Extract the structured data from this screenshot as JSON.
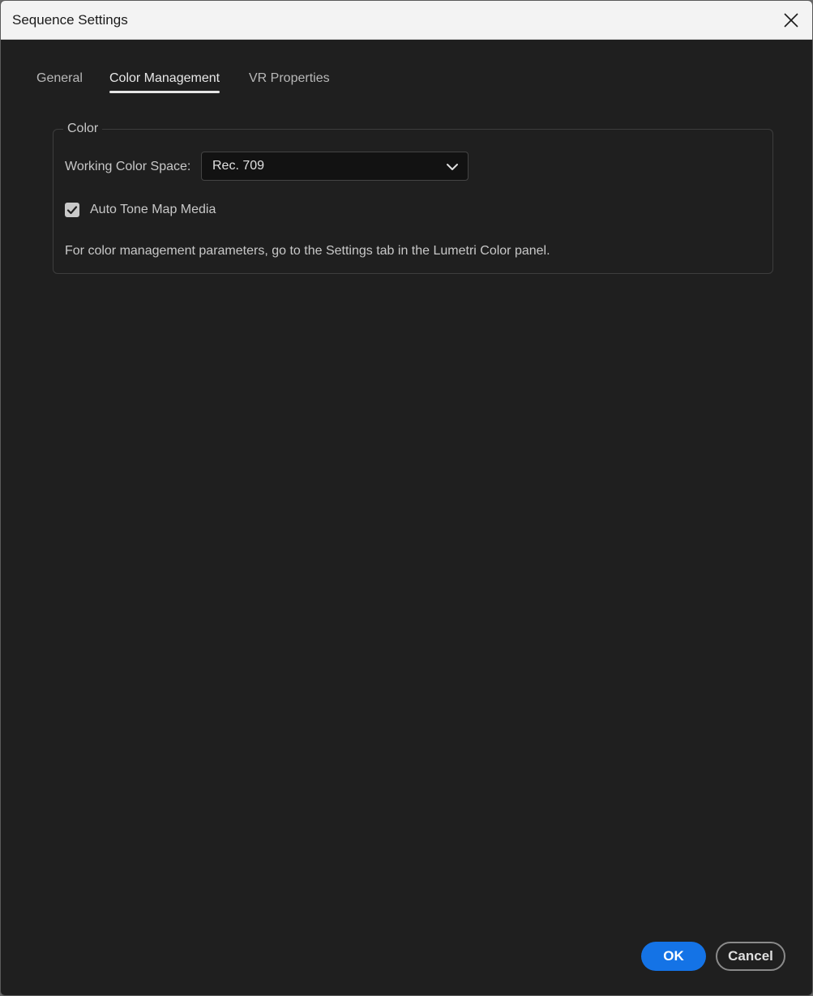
{
  "window": {
    "title": "Sequence Settings"
  },
  "tabs": [
    {
      "label": "General",
      "active": false
    },
    {
      "label": "Color Management",
      "active": true
    },
    {
      "label": "VR Properties",
      "active": false
    }
  ],
  "color_group": {
    "legend": "Color",
    "working_color_space": {
      "label": "Working Color Space:",
      "value": "Rec. 709"
    },
    "auto_tone_map": {
      "label": "Auto Tone Map Media",
      "checked": true
    },
    "note": "For color management parameters, go to the Settings tab in the Lumetri Color panel."
  },
  "buttons": {
    "ok": "OK",
    "cancel": "Cancel"
  },
  "colors": {
    "accent": "#1473e6",
    "panel_bg": "#1f1f1f",
    "titlebar_bg": "#f3f3f3"
  },
  "icons": {
    "close": "close-icon",
    "dropdown": "chevron-down-icon",
    "checkbox": "checkmark-icon"
  }
}
